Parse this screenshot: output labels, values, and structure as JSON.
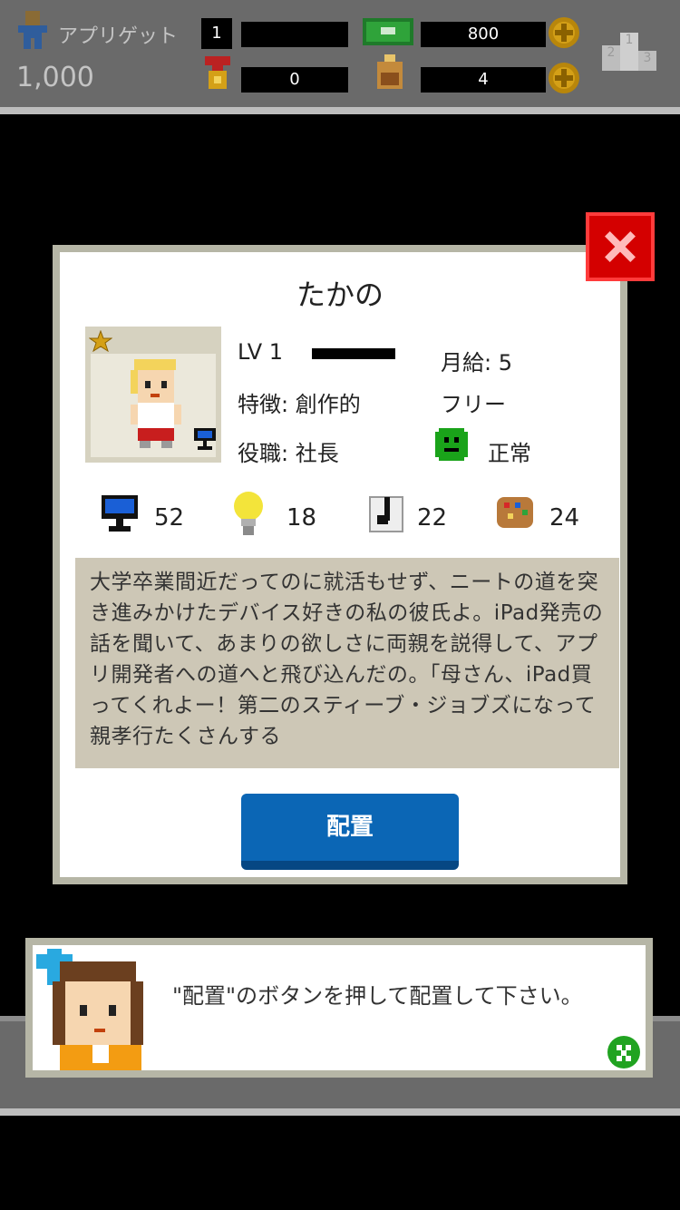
{
  "topbar": {
    "company_name": "アプリゲット",
    "money": "1,000",
    "rank": "1",
    "fans": "800",
    "medals": "0",
    "ideas": "4",
    "ranking_numbers": [
      "1",
      "2",
      "3"
    ]
  },
  "character": {
    "name": "たかの",
    "level": "LV 1",
    "salary": "月給: 5",
    "trait": "特徴: 創作的",
    "contract": "フリー",
    "position": "役職: 社長",
    "condition": "正常",
    "stats": {
      "programming": "52",
      "idea": "18",
      "music": "22",
      "art": "24"
    },
    "description": "大学卒業間近だってのに就活もせず、ニートの道を突き進みかけたデバイス好きの私の彼氏よ。iPad発売の話を聞いて、あまりの欲しさに両親を説得して、アプリ開発者への道へと飛び込んだの。「母さん、iPad買ってくれよー！第二のスティーブ・ジョブズになって親孝行たくさんする"
  },
  "buttons": {
    "place": "配置"
  },
  "dialog": {
    "message": "\"配置\"のボタンを押して配置して下さい。"
  },
  "colors": {
    "close": "#d40000",
    "place_button": "#0b66b5",
    "panel_border": "#b6b6a6",
    "desc_bg": "#cdc7b6",
    "topbar_bg": "#6a6a6a"
  }
}
